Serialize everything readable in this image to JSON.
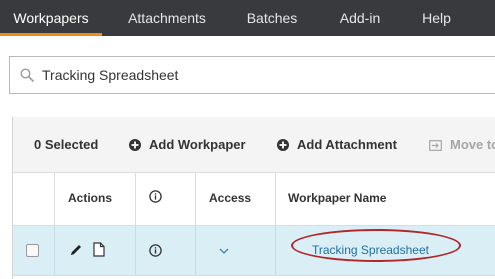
{
  "nav": {
    "tabs": [
      {
        "label": "Workpapers",
        "active": true
      },
      {
        "label": "Attachments",
        "active": false
      },
      {
        "label": "Batches",
        "active": false
      },
      {
        "label": "Add-in",
        "active": false
      },
      {
        "label": "Help",
        "active": false
      }
    ]
  },
  "search": {
    "value": "Tracking Spreadsheet",
    "icon": "search-icon"
  },
  "toolbar": {
    "selected_label": "0 Selected",
    "add_workpaper_label": "Add Workpaper",
    "add_attachment_label": "Add Attachment",
    "move_label": "Move to"
  },
  "table": {
    "headers": {
      "actions": "Actions",
      "info": "info-icon",
      "access": "Access",
      "name": "Workpaper Name"
    },
    "rows": [
      {
        "checked": false,
        "actions": [
          "pencil-icon",
          "document-icon"
        ],
        "info": "info-icon",
        "access": "chevron-down-icon",
        "name": "Tracking Spreadsheet",
        "highlighted": true
      }
    ]
  },
  "colors": {
    "nav_bg": "#393a3e",
    "active_tab_underline": "#f08a1d",
    "selected_row_bg": "#daeef6",
    "link": "#1f6ea6",
    "annotation_circle": "#b0262a"
  }
}
